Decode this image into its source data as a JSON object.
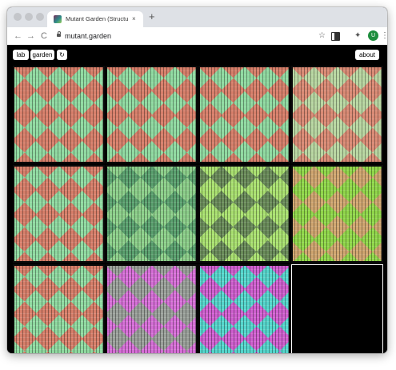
{
  "browser": {
    "tab_title": "Mutant Garden (Structures of",
    "tab_close": "×",
    "new_tab": "+",
    "url": "mutant.garden",
    "nav": {
      "back": "←",
      "forward": "→",
      "reload": "C"
    },
    "toolbar": {
      "star": "☆",
      "avatar_letter": "U",
      "menu": "⋮"
    }
  },
  "site": {
    "nav": {
      "lab": "lab",
      "garden": "garden",
      "refresh": "↻",
      "about": "about"
    }
  },
  "gallery": {
    "tiles": [
      {
        "palette": "coral-green"
      },
      {
        "palette": "coral-green"
      },
      {
        "palette": "coral-green"
      },
      {
        "palette": "coral-pink"
      },
      {
        "palette": "coral-green"
      },
      {
        "palette": "green-magenta"
      },
      {
        "palette": "lime-purple"
      },
      {
        "palette": "lime-green"
      },
      {
        "palette": "coral-green"
      },
      {
        "palette": "gray-magenta"
      },
      {
        "palette": "magenta-teal"
      },
      {
        "palette": "empty"
      }
    ]
  },
  "colors": {
    "coral-green": [
      "#d77f6a",
      "#8fd9a0",
      "#e5b77a",
      "#5ea07a"
    ],
    "coral-pink": [
      "#d98a74",
      "#b8d6a1",
      "#e8a89a",
      "#7fb08a"
    ],
    "green-magenta": [
      "#8ccf8a",
      "#5aa06e",
      "#b06ab8",
      "#d2c6a6"
    ],
    "lime-purple": [
      "#a9e070",
      "#6a8c5a",
      "#c3c790",
      "#6e6a8a"
    ],
    "lime-green": [
      "#90d64a",
      "#d0a670",
      "#4f9e4f",
      "#c9e67a"
    ],
    "gray-magenta": [
      "#9aa09a",
      "#d56ed6",
      "#b9a5c8",
      "#7fc48a"
    ],
    "magenta-teal": [
      "#cf5fcf",
      "#55d6cc",
      "#8a4a8a",
      "#e08ae0"
    ]
  }
}
